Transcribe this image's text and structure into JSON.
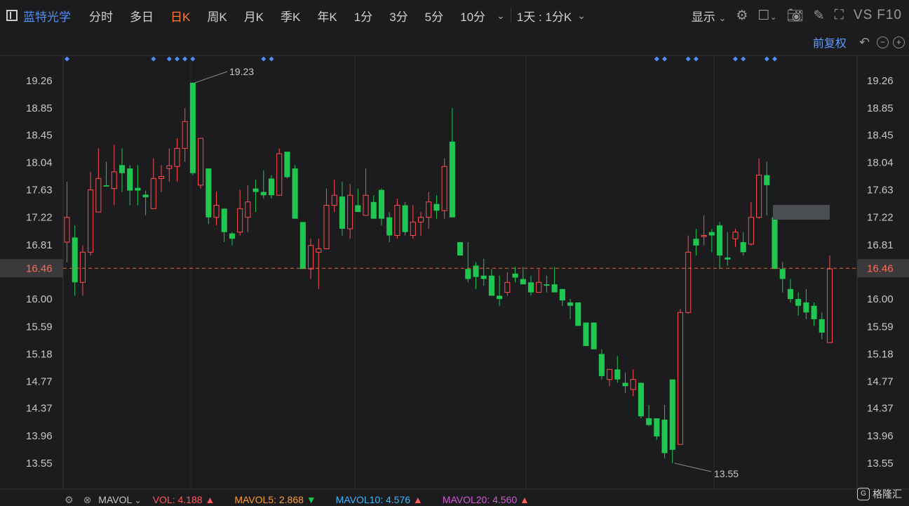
{
  "toolbar": {
    "stock_name": "蓝特光学",
    "tabs": [
      "分时",
      "多日",
      "日K",
      "周K",
      "月K",
      "季K",
      "年K",
      "1分",
      "3分",
      "5分",
      "10分"
    ],
    "active_tab": "日K",
    "period_select": "1天 : 1分K",
    "display_label": "显示",
    "vs_label": "VS",
    "f10_label": "F10"
  },
  "adjust": {
    "label": "前复权"
  },
  "bottom": {
    "mavol_label": "MAVOL",
    "vol_label": "VOL:",
    "vol_value": "4.188",
    "mavol5_label": "MAVOL5:",
    "mavol5_value": "2.868",
    "mavol10_label": "MAVOL10:",
    "mavol10_value": "4.576",
    "mavol20_label": "MAVOL20:",
    "mavol20_value": "4.560"
  },
  "watermark": {
    "text": "格隆汇"
  },
  "colors": {
    "up": "#ff4d4f",
    "down": "#1fc752",
    "grid": "#2c2c2e",
    "axis_text": "#c8c8c8",
    "current_line": "#e0643a",
    "marker": "#4f8ff7",
    "mavol5": "#ff9f2f",
    "mavol10": "#3db6ff",
    "mavol20": "#d05ad6"
  },
  "chart_data": {
    "type": "candlestick",
    "y_ticks": [
      "19.26",
      "18.85",
      "18.45",
      "18.04",
      "17.63",
      "17.22",
      "16.81",
      "16.46",
      "16.00",
      "15.59",
      "15.18",
      "14.77",
      "14.37",
      "13.96",
      "13.55"
    ],
    "ylim": [
      13.4,
      19.5
    ],
    "current_price": "16.46",
    "high_label": "19.23",
    "low_label": "13.55",
    "marker_slots": [
      0,
      11,
      13,
      14,
      15,
      16,
      25,
      26,
      75,
      76,
      79,
      80,
      85,
      86,
      89,
      90
    ],
    "candles": [
      {
        "o": 16.85,
        "h": 17.75,
        "l": 16.55,
        "c": 17.22
      },
      {
        "o": 16.92,
        "h": 17.1,
        "l": 16.05,
        "c": 16.25
      },
      {
        "o": 16.25,
        "h": 16.8,
        "l": 16.05,
        "c": 16.7
      },
      {
        "o": 16.7,
        "h": 17.9,
        "l": 16.65,
        "c": 17.63
      },
      {
        "o": 17.3,
        "h": 18.25,
        "l": 17.3,
        "c": 17.8
      },
      {
        "o": 17.7,
        "h": 18.05,
        "l": 17.7,
        "c": 17.68
      },
      {
        "o": 17.65,
        "h": 18.3,
        "l": 17.4,
        "c": 17.9
      },
      {
        "o": 18.0,
        "h": 18.25,
        "l": 17.6,
        "c": 17.88
      },
      {
        "o": 17.95,
        "h": 18.0,
        "l": 17.4,
        "c": 17.62
      },
      {
        "o": 17.66,
        "h": 18.0,
        "l": 17.4,
        "c": 17.62
      },
      {
        "o": 17.56,
        "h": 17.62,
        "l": 17.25,
        "c": 17.52
      },
      {
        "o": 17.35,
        "h": 18.1,
        "l": 17.35,
        "c": 17.8
      },
      {
        "o": 17.8,
        "h": 18.0,
        "l": 17.6,
        "c": 17.83
      },
      {
        "o": 17.95,
        "h": 18.25,
        "l": 17.75,
        "c": 17.99
      },
      {
        "o": 17.98,
        "h": 18.4,
        "l": 17.75,
        "c": 18.25
      },
      {
        "o": 18.25,
        "h": 18.85,
        "l": 18.05,
        "c": 18.65
      },
      {
        "o": 19.23,
        "h": 19.23,
        "l": 17.85,
        "c": 17.88
      },
      {
        "o": 17.7,
        "h": 18.4,
        "l": 17.65,
        "c": 18.4
      },
      {
        "o": 17.95,
        "h": 17.95,
        "l": 17.12,
        "c": 17.22
      },
      {
        "o": 17.22,
        "h": 17.6,
        "l": 17.1,
        "c": 17.4
      },
      {
        "o": 17.35,
        "h": 17.35,
        "l": 16.85,
        "c": 17.0
      },
      {
        "o": 16.98,
        "h": 17.0,
        "l": 16.8,
        "c": 16.9
      },
      {
        "o": 17.0,
        "h": 17.63,
        "l": 16.95,
        "c": 17.35
      },
      {
        "o": 17.22,
        "h": 17.7,
        "l": 17.0,
        "c": 17.45
      },
      {
        "o": 17.65,
        "h": 17.78,
        "l": 17.3,
        "c": 17.6
      },
      {
        "o": 17.6,
        "h": 17.92,
        "l": 17.5,
        "c": 17.55
      },
      {
        "o": 17.8,
        "h": 17.85,
        "l": 17.5,
        "c": 17.55
      },
      {
        "o": 17.55,
        "h": 18.25,
        "l": 17.55,
        "c": 18.17
      },
      {
        "o": 18.2,
        "h": 18.15,
        "l": 17.8,
        "c": 17.82
      },
      {
        "o": 17.95,
        "h": 18.0,
        "l": 17.2,
        "c": 17.2
      },
      {
        "o": 17.15,
        "h": 17.15,
        "l": 16.45,
        "c": 16.45
      },
      {
        "o": 16.45,
        "h": 16.9,
        "l": 16.3,
        "c": 16.8
      },
      {
        "o": 16.7,
        "h": 16.9,
        "l": 16.15,
        "c": 16.75
      },
      {
        "o": 16.75,
        "h": 17.65,
        "l": 16.75,
        "c": 17.4
      },
      {
        "o": 17.4,
        "h": 17.78,
        "l": 17.3,
        "c": 17.55
      },
      {
        "o": 17.53,
        "h": 17.75,
        "l": 16.95,
        "c": 17.05
      },
      {
        "o": 17.05,
        "h": 17.72,
        "l": 16.9,
        "c": 17.55
      },
      {
        "o": 17.4,
        "h": 17.65,
        "l": 17.35,
        "c": 17.3
      },
      {
        "o": 17.25,
        "h": 17.95,
        "l": 17.3,
        "c": 17.55
      },
      {
        "o": 17.45,
        "h": 17.55,
        "l": 17.25,
        "c": 17.2
      },
      {
        "o": 17.63,
        "h": 17.65,
        "l": 17.1,
        "c": 17.2
      },
      {
        "o": 17.22,
        "h": 17.3,
        "l": 16.85,
        "c": 16.95
      },
      {
        "o": 16.95,
        "h": 17.5,
        "l": 16.9,
        "c": 17.4
      },
      {
        "o": 17.4,
        "h": 17.45,
        "l": 16.95,
        "c": 17.0
      },
      {
        "o": 16.95,
        "h": 17.4,
        "l": 16.9,
        "c": 17.15
      },
      {
        "o": 17.15,
        "h": 17.3,
        "l": 16.95,
        "c": 17.22
      },
      {
        "o": 17.22,
        "h": 17.6,
        "l": 17.05,
        "c": 17.45
      },
      {
        "o": 17.42,
        "h": 17.55,
        "l": 17.2,
        "c": 17.32
      },
      {
        "o": 17.32,
        "h": 18.1,
        "l": 17.2,
        "c": 17.98
      },
      {
        "o": 18.35,
        "h": 18.85,
        "l": 17.22,
        "c": 17.22
      },
      {
        "o": 16.85,
        "h": 16.85,
        "l": 16.65,
        "c": 16.65
      },
      {
        "o": 16.45,
        "h": 16.85,
        "l": 16.25,
        "c": 16.3
      },
      {
        "o": 16.5,
        "h": 16.55,
        "l": 16.15,
        "c": 16.33
      },
      {
        "o": 16.35,
        "h": 16.6,
        "l": 16.2,
        "c": 16.3
      },
      {
        "o": 16.35,
        "h": 16.45,
        "l": 16.05,
        "c": 16.05
      },
      {
        "o": 16.05,
        "h": 16.35,
        "l": 15.9,
        "c": 16.0
      },
      {
        "o": 16.1,
        "h": 16.4,
        "l": 16.05,
        "c": 16.25
      },
      {
        "o": 16.38,
        "h": 16.48,
        "l": 16.25,
        "c": 16.32
      },
      {
        "o": 16.3,
        "h": 16.48,
        "l": 16.25,
        "c": 16.22
      },
      {
        "o": 16.25,
        "h": 16.35,
        "l": 16.05,
        "c": 16.1
      },
      {
        "o": 16.1,
        "h": 16.45,
        "l": 16.1,
        "c": 16.25
      },
      {
        "o": 16.22,
        "h": 16.35,
        "l": 16.1,
        "c": 16.2
      },
      {
        "o": 16.22,
        "h": 16.48,
        "l": 16.1,
        "c": 16.1
      },
      {
        "o": 16.15,
        "h": 16.15,
        "l": 15.9,
        "c": 15.98
      },
      {
        "o": 15.95,
        "h": 16.0,
        "l": 15.7,
        "c": 15.9
      },
      {
        "o": 15.95,
        "h": 15.95,
        "l": 15.6,
        "c": 15.6
      },
      {
        "o": 15.65,
        "h": 15.65,
        "l": 15.3,
        "c": 15.3
      },
      {
        "o": 15.65,
        "h": 15.65,
        "l": 15.25,
        "c": 15.25
      },
      {
        "o": 15.18,
        "h": 15.25,
        "l": 14.8,
        "c": 14.85
      },
      {
        "o": 14.8,
        "h": 14.95,
        "l": 14.7,
        "c": 14.95
      },
      {
        "o": 14.95,
        "h": 15.15,
        "l": 14.75,
        "c": 14.8
      },
      {
        "o": 14.75,
        "h": 14.9,
        "l": 14.6,
        "c": 14.7
      },
      {
        "o": 14.65,
        "h": 14.95,
        "l": 14.55,
        "c": 14.8
      },
      {
        "o": 14.75,
        "h": 14.75,
        "l": 14.22,
        "c": 14.25
      },
      {
        "o": 14.22,
        "h": 14.42,
        "l": 14.1,
        "c": 14.12
      },
      {
        "o": 14.22,
        "h": 14.22,
        "l": 13.9,
        "c": 13.95
      },
      {
        "o": 14.2,
        "h": 14.42,
        "l": 13.62,
        "c": 13.7
      },
      {
        "o": 14.8,
        "h": 14.8,
        "l": 13.55,
        "c": 13.75
      },
      {
        "o": 13.83,
        "h": 15.85,
        "l": 13.83,
        "c": 15.8
      },
      {
        "o": 15.8,
        "h": 16.95,
        "l": 15.78,
        "c": 16.7
      },
      {
        "o": 16.9,
        "h": 17.05,
        "l": 16.65,
        "c": 16.8
      },
      {
        "o": 16.95,
        "h": 17.25,
        "l": 16.8,
        "c": 16.95
      },
      {
        "o": 17.0,
        "h": 17.05,
        "l": 16.7,
        "c": 16.95
      },
      {
        "o": 17.1,
        "h": 17.15,
        "l": 16.45,
        "c": 16.65
      },
      {
        "o": 16.62,
        "h": 17.0,
        "l": 16.5,
        "c": 16.59
      },
      {
        "o": 16.9,
        "h": 17.05,
        "l": 16.78,
        "c": 17.0
      },
      {
        "o": 16.85,
        "h": 17.0,
        "l": 16.65,
        "c": 16.7
      },
      {
        "o": 16.82,
        "h": 17.45,
        "l": 16.8,
        "c": 17.22
      },
      {
        "o": 17.22,
        "h": 18.1,
        "l": 17.2,
        "c": 17.85
      },
      {
        "o": 17.85,
        "h": 18.05,
        "l": 17.25,
        "c": 17.7
      },
      {
        "o": 17.22,
        "h": 17.22,
        "l": 16.45,
        "c": 16.45
      },
      {
        "o": 16.45,
        "h": 16.55,
        "l": 16.1,
        "c": 16.3
      },
      {
        "o": 16.15,
        "h": 16.3,
        "l": 15.95,
        "c": 16.0
      },
      {
        "o": 16.0,
        "h": 16.1,
        "l": 15.75,
        "c": 15.9
      },
      {
        "o": 15.95,
        "h": 16.15,
        "l": 15.7,
        "c": 15.8
      },
      {
        "o": 15.9,
        "h": 15.95,
        "l": 15.6,
        "c": 15.7
      },
      {
        "o": 15.7,
        "h": 15.8,
        "l": 15.4,
        "c": 15.5
      },
      {
        "o": 15.35,
        "h": 16.65,
        "l": 15.35,
        "c": 16.45
      }
    ]
  }
}
